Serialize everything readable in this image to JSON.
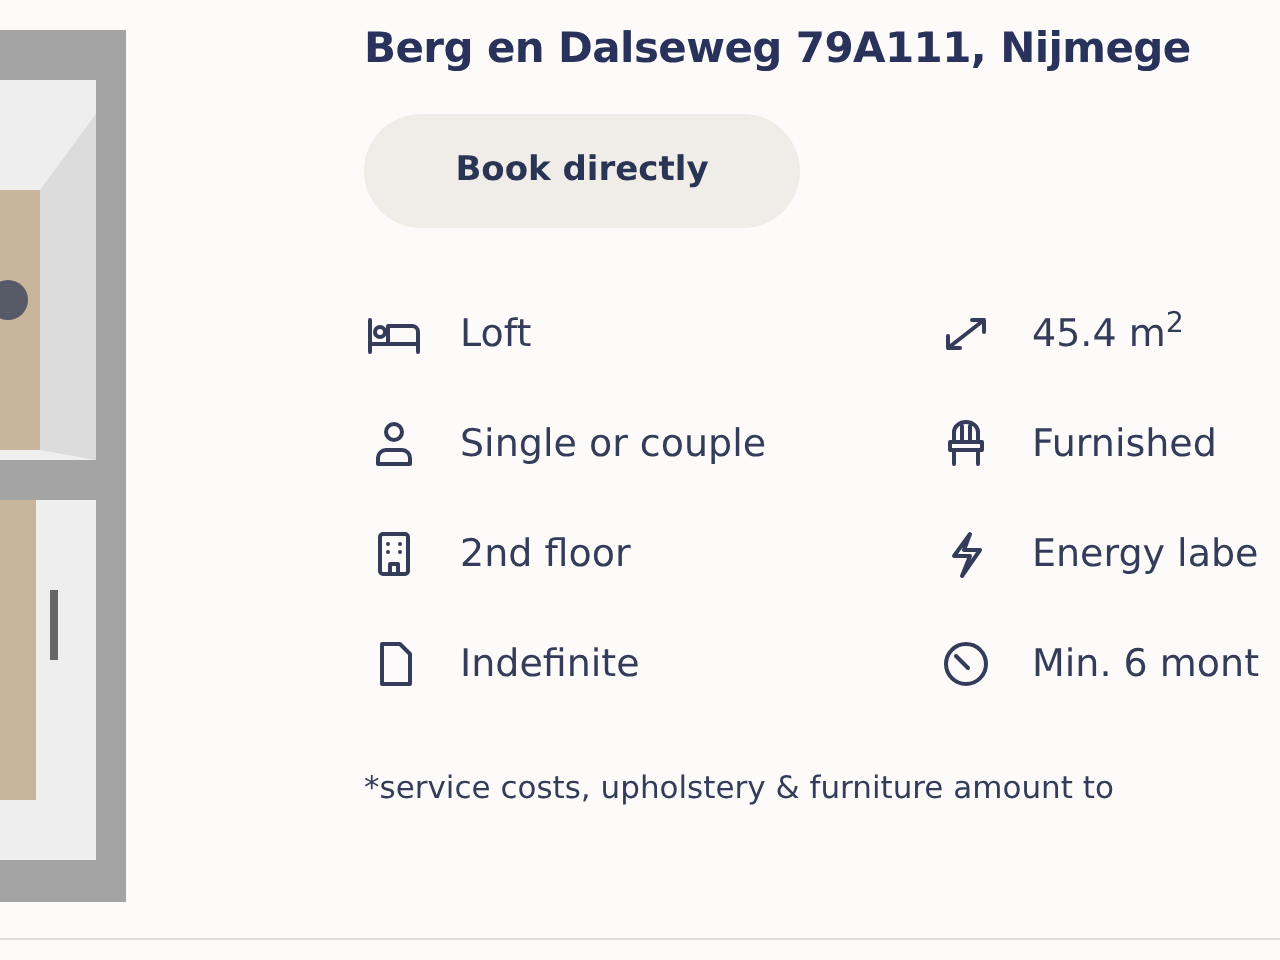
{
  "title": "Berg en Dalseweg 79A111, Nijmege",
  "button": "Book directly",
  "features": [
    {
      "kind": "bed",
      "text": "Loft"
    },
    {
      "kind": "resize",
      "text": "45.4 m$^{2}$"
    },
    {
      "kind": "person",
      "text": "Single or couple"
    },
    {
      "kind": "chair",
      "text": "Furnished"
    },
    {
      "kind": "building",
      "text": "2nd floor"
    },
    {
      "kind": "bolt",
      "text": "Energy labe"
    },
    {
      "kind": "document",
      "text": "Indefinite"
    },
    {
      "kind": "clock",
      "text": "Min. 6 mont"
    }
  ],
  "footnote": "*service costs, upholstery & furniture amount to"
}
